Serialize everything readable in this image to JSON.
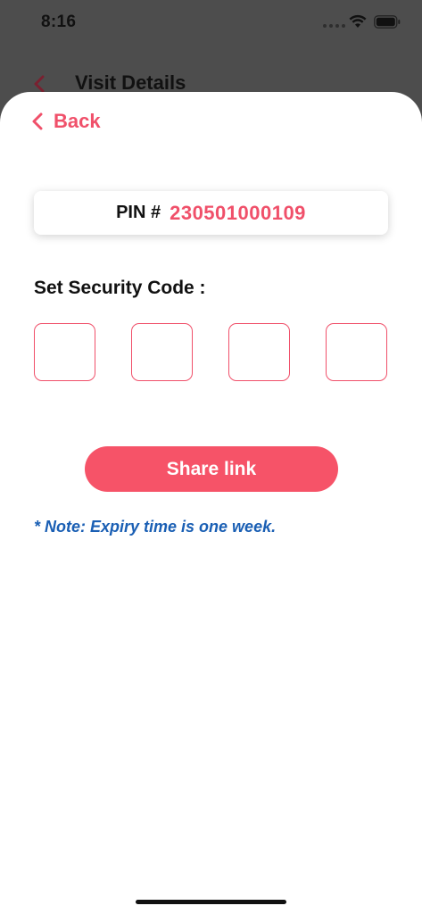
{
  "status_bar": {
    "time": "8:16",
    "wifi_icon": "wifi-icon",
    "battery_icon": "battery-icon"
  },
  "background_screen": {
    "title": "Visit Details",
    "back_icon": "chevron-left-icon"
  },
  "sheet": {
    "back_label": "Back",
    "back_icon": "chevron-left-icon",
    "pin": {
      "label": "PIN #",
      "value": "230501000109"
    },
    "security_code": {
      "title": "Set Security Code :",
      "digits": [
        "",
        "",
        "",
        ""
      ]
    },
    "share_button_label": "Share link",
    "note": "* Note: Expiry time is one week."
  },
  "colors": {
    "accent": "#f0506a",
    "button": "#f65368",
    "note": "#1a5fb4",
    "backdrop": "#4d4d4d"
  }
}
